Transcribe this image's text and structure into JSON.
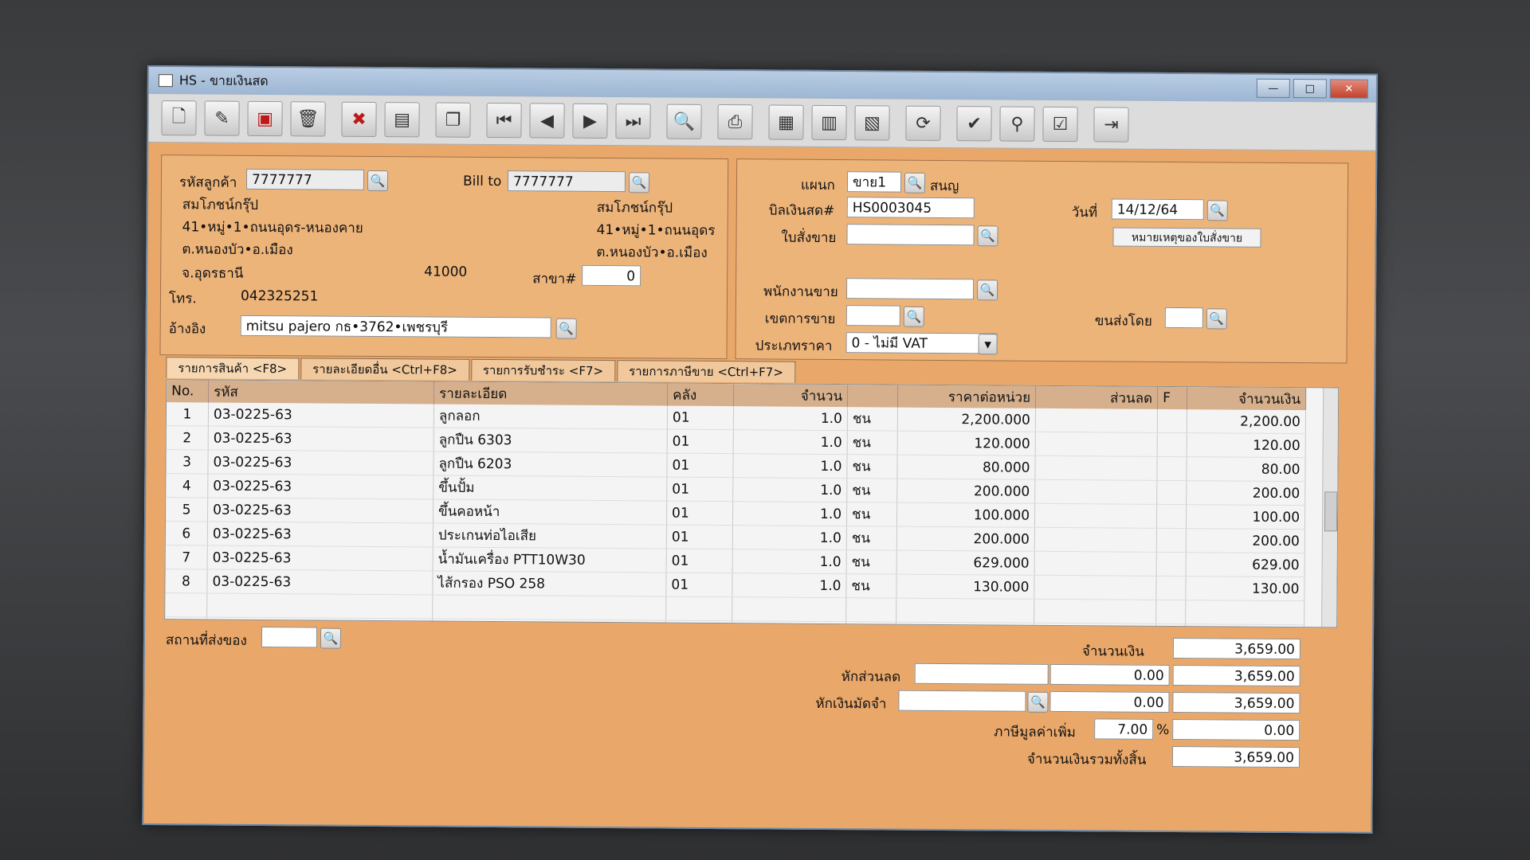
{
  "window": {
    "title": "HS - ขายเงินสด"
  },
  "toolbar": {
    "icons": [
      "new-icon",
      "edit-icon",
      "void-icon",
      "delete-icon",
      "cancel-icon",
      "save-icon",
      "copy-icon",
      "first-icon",
      "prev-icon",
      "next-icon",
      "last-icon",
      "search-icon",
      "print-icon",
      "calc-icon",
      "report-icon",
      "so-icon",
      "refresh-icon",
      "approve-icon",
      "link-icon",
      "ok-icon",
      "exit-icon"
    ]
  },
  "customer": {
    "code_label": "รหัสลูกค้า",
    "code": "7777777",
    "billto_label": "Bill to",
    "billto": "7777777",
    "name": "สมโภชน์กรุ๊ป",
    "addr1": "41•หมู่•1•ถนนอุดร-หนองคาย",
    "addr2": "ต.หนองบัว•อ.เมือง",
    "addr3": "จ.อุดรธานี",
    "zip": "41000",
    "billto_name": "สมโภชน์กรุ๊ป",
    "billto_addr1": "41•หมู่•1•ถนนอุดร",
    "billto_addr2": "ต.หนองบัว•อ.เมือง",
    "branch_label": "สาขา#",
    "branch": "0",
    "tel_label": "โทร.",
    "tel": "042325251",
    "ref_label": "อ้างอิง",
    "ref": "mitsu pajero กธ•3762•เพชรบุรี"
  },
  "doc": {
    "dept_label": "แผนก",
    "dept": "ขาย1",
    "dept_name": "สนญ",
    "bill_label": "บิลเงินสด#",
    "bill": "HS0003045",
    "date_label": "วันที่",
    "date": "14/12/64",
    "order_label": "ใบสั่งขาย",
    "order_note_btn": "หมายเหตุของใบสั่งขาย",
    "sales_label": "พนักงานขาย",
    "area_label": "เขตการขาย",
    "ship_label": "ขนส่งโดย",
    "price_label": "ประเภทราคา",
    "price_type": "0 - ไม่มี VAT"
  },
  "tabs": [
    "รายการสินค้า <F8>",
    "รายละเอียดอื่น <Ctrl+F8>",
    "รายการรับชำระ <F7>",
    "รายการภาษีขาย <Ctrl+F7>"
  ],
  "grid": {
    "headers": [
      "No.",
      "รหัส",
      "รายละเอียด",
      "คลัง",
      "จำนวน",
      "",
      "ราคาต่อหน่วย",
      "ส่วนลด",
      "F",
      "จำนวนเงิน"
    ],
    "rows": [
      [
        "1",
        "03-0225-63",
        "ลูกลอก",
        "01",
        "1.0",
        "ชน",
        "2,200.000",
        "",
        "",
        "2,200.00"
      ],
      [
        "2",
        "03-0225-63",
        "ลูกปืน 6303",
        "01",
        "1.0",
        "ชน",
        "120.000",
        "",
        "",
        "120.00"
      ],
      [
        "3",
        "03-0225-63",
        "ลูกปืน 6203",
        "01",
        "1.0",
        "ชน",
        "80.000",
        "",
        "",
        "80.00"
      ],
      [
        "4",
        "03-0225-63",
        "ขึ้นปั้ม",
        "01",
        "1.0",
        "ชน",
        "200.000",
        "",
        "",
        "200.00"
      ],
      [
        "5",
        "03-0225-63",
        "ขึ้นคอหน้า",
        "01",
        "1.0",
        "ชน",
        "100.000",
        "",
        "",
        "100.00"
      ],
      [
        "6",
        "03-0225-63",
        "ประเกนท่อไอเสีย",
        "01",
        "1.0",
        "ชน",
        "200.000",
        "",
        "",
        "200.00"
      ],
      [
        "7",
        "03-0225-63",
        "น้ำมันเครื่อง PTT10W30",
        "01",
        "1.0",
        "ชน",
        "629.000",
        "",
        "",
        "629.00"
      ],
      [
        "8",
        "03-0225-63",
        "ไส้กรอง PSO 258",
        "01",
        "1.0",
        "ชน",
        "130.000",
        "",
        "",
        "130.00"
      ]
    ]
  },
  "footer": {
    "shipto_label": "สถานที่ส่งของ",
    "amount_label": "จำนวนเงิน",
    "amount": "3,659.00",
    "discount_label": "หักส่วนลด",
    "discount": "0.00",
    "after_discount": "3,659.00",
    "deposit_label": "หักเงินมัดจำ",
    "deposit": "0.00",
    "after_deposit": "3,659.00",
    "vat_label": "ภาษีมูลค่าเพิ่ม",
    "vat_rate": "7.00",
    "vat_pct": "%",
    "vat": "0.00",
    "total_label": "จำนวนเงินรวมทั้งสิ้น",
    "total": "3,659.00"
  }
}
